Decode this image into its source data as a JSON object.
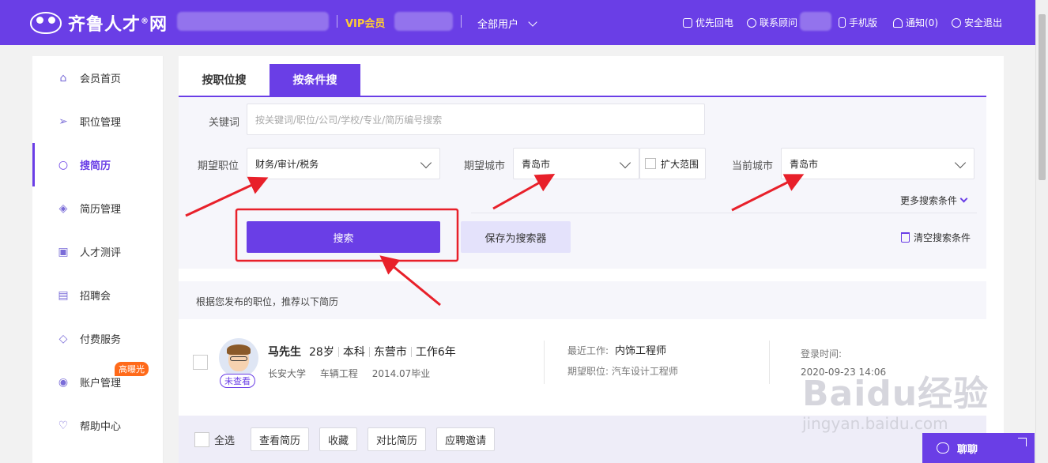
{
  "header": {
    "logo_text": "齐鲁人才",
    "logo_suffix": "网",
    "logo_reg": "®",
    "vip_label": "VIP会员",
    "users_dropdown": "全部用户",
    "links": [
      {
        "label": "优先回电",
        "icon": "phone-icon"
      },
      {
        "label": "联系顾问",
        "icon": "headset-icon"
      },
      {
        "label": "手机版",
        "icon": "mobile-icon"
      },
      {
        "label": "通知(0)",
        "icon": "bell-icon"
      },
      {
        "label": "安全退出",
        "icon": "logout-icon"
      }
    ]
  },
  "sidebar": {
    "items": [
      {
        "label": "会员首页",
        "icon": "home-icon",
        "active": false
      },
      {
        "label": "职位管理",
        "icon": "send-icon",
        "active": false
      },
      {
        "label": "搜简历",
        "icon": "search-icon",
        "active": true
      },
      {
        "label": "简历管理",
        "icon": "layers-icon",
        "active": false
      },
      {
        "label": "人才测评",
        "icon": "clipboard-icon",
        "active": false
      },
      {
        "label": "招聘会",
        "icon": "calendar-icon",
        "active": false
      },
      {
        "label": "付费服务",
        "icon": "diamond-icon",
        "active": false
      },
      {
        "label": "账户管理",
        "icon": "user-icon",
        "active": false,
        "badge": "高曝光"
      },
      {
        "label": "帮助中心",
        "icon": "heart-icon",
        "active": false
      }
    ]
  },
  "tabs": [
    {
      "label": "按职位搜",
      "active": false
    },
    {
      "label": "按条件搜",
      "active": true
    }
  ],
  "filters": {
    "keyword_label": "关键词",
    "keyword_placeholder": "按关键词/职位/公司/学校/专业/简历编号搜索",
    "position_label": "期望职位",
    "position_value": "财务/审计/税务",
    "city_label": "期望城市",
    "city_value": "青岛市",
    "expand_label": "扩大范围",
    "current_city_label": "当前城市",
    "current_city_value": "青岛市",
    "more_conditions": "更多搜索条件",
    "search_button": "搜索",
    "save_button": "保存为搜索器",
    "clear_button": "清空搜索条件"
  },
  "recommend_text": "根据您发布的职位，推荐以下简历",
  "resume": {
    "name": "马先生",
    "age": "28岁",
    "education": "本科",
    "location": "东营市",
    "experience": "工作6年",
    "school": "长安大学",
    "major": "车辆工程",
    "graduation": "2014.07毕业",
    "status_badge": "未查看",
    "recent_work_label": "最近工作:",
    "recent_work_value": "内饰工程师",
    "expected_position": "期望职位: 汽车设计工程师",
    "login_label": "登录时间:",
    "login_time": "2020-09-23 14:06"
  },
  "actions": {
    "select_all": "全选",
    "buttons": [
      "查看简历",
      "收藏",
      "对比简历",
      "应聘邀请"
    ]
  },
  "chat": {
    "label": "聊聊"
  },
  "watermark": {
    "brand": "Baidu经验",
    "url": "jingyan.baidu.com"
  },
  "colors": {
    "brand": "#6a3ee6",
    "vip": "#ffcc33",
    "annotation": "#e8202a",
    "badge": "#ff6a1a"
  }
}
